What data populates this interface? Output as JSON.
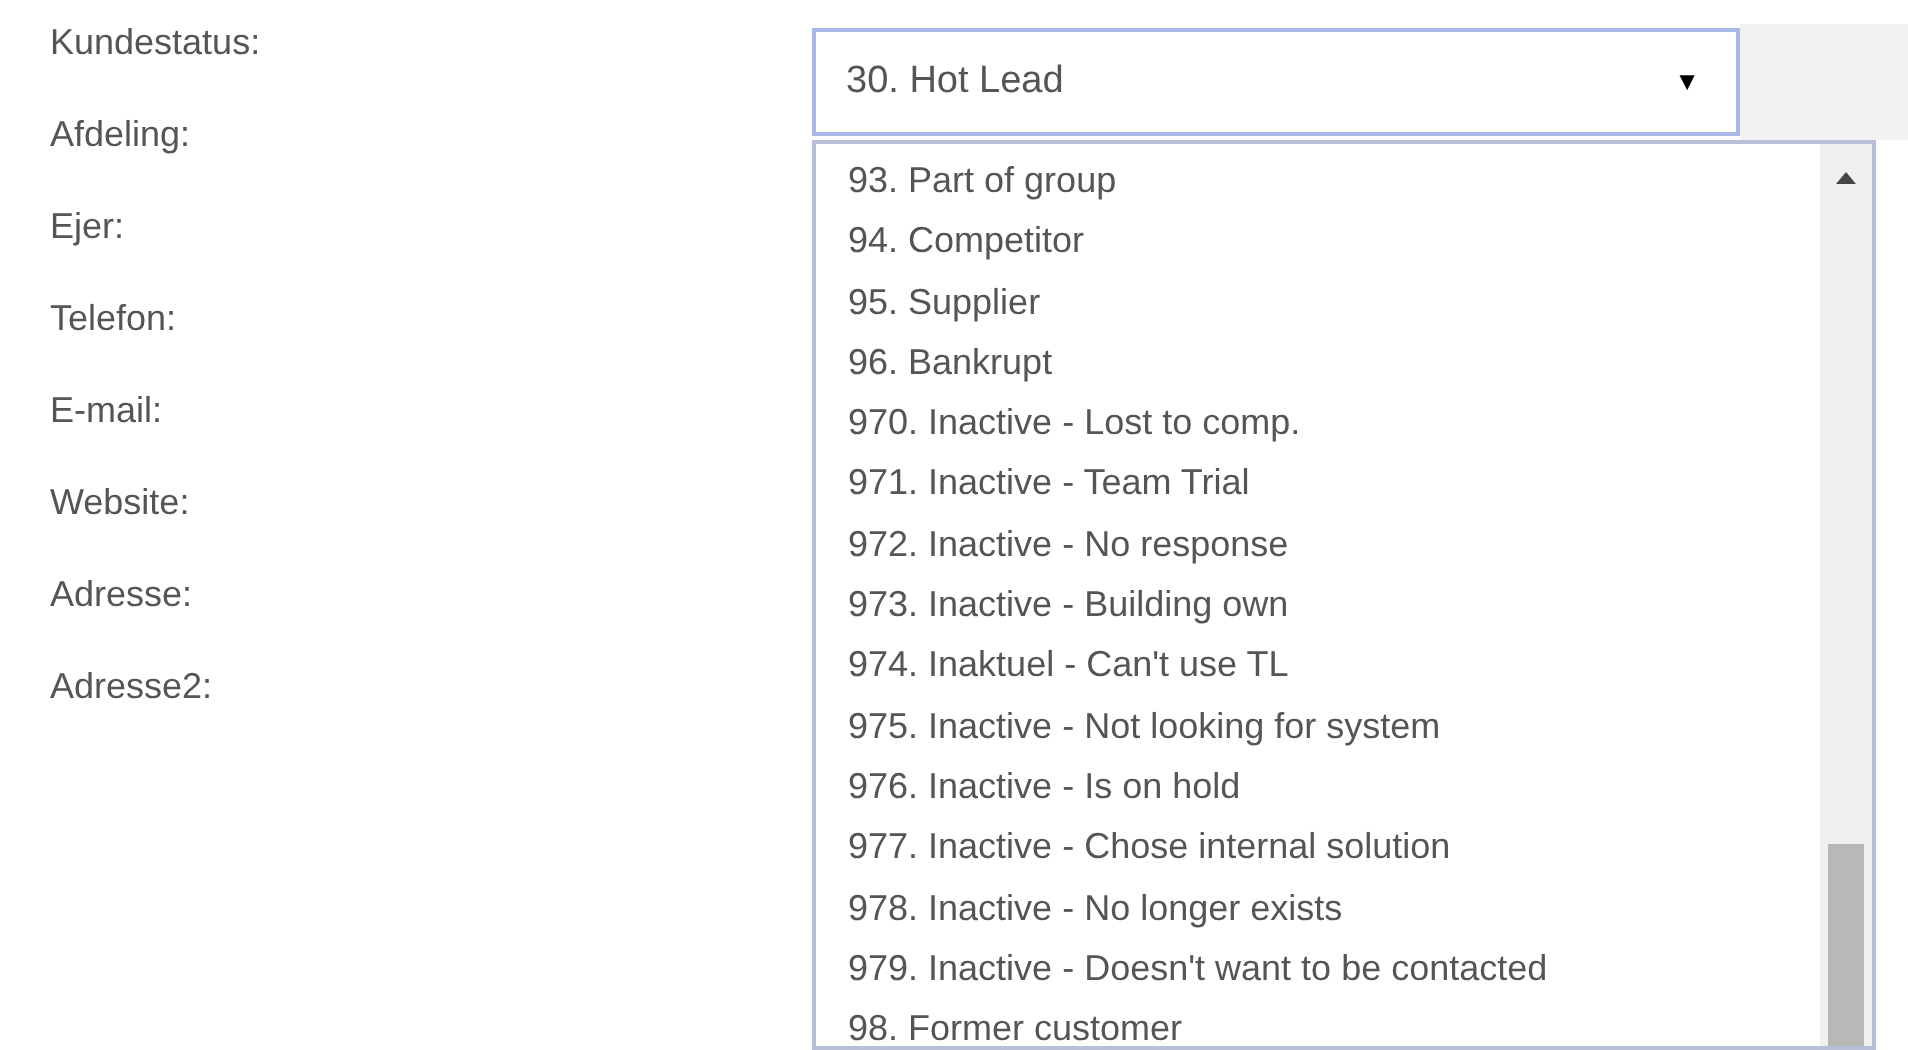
{
  "fields": [
    {
      "label": "Kundestatus:"
    },
    {
      "label": "Afdeling:"
    },
    {
      "label": "Ejer:"
    },
    {
      "label": "Telefon:"
    },
    {
      "label": "E-mail:"
    },
    {
      "label": "Website:"
    },
    {
      "label": "Adresse:"
    },
    {
      "label": "Adresse2:"
    }
  ],
  "select": {
    "value": "30. Hot Lead",
    "arrow": "▼"
  },
  "options": [
    "93. Part of group",
    "94. Competitor",
    "95. Supplier",
    "96. Bankrupt",
    "970. Inactive - Lost to comp.",
    "971. Inactive - Team Trial",
    "972. Inactive - No response",
    "973. Inactive - Building own",
    "974. Inaktuel - Can't use TL",
    "975. Inactive - Not looking for system",
    "976. Inactive - Is on hold",
    "977. Inactive - Chose internal solution",
    "978. Inactive - No longer exists",
    "979. Inactive - Doesn't want to be contacted",
    "98. Former customer"
  ]
}
